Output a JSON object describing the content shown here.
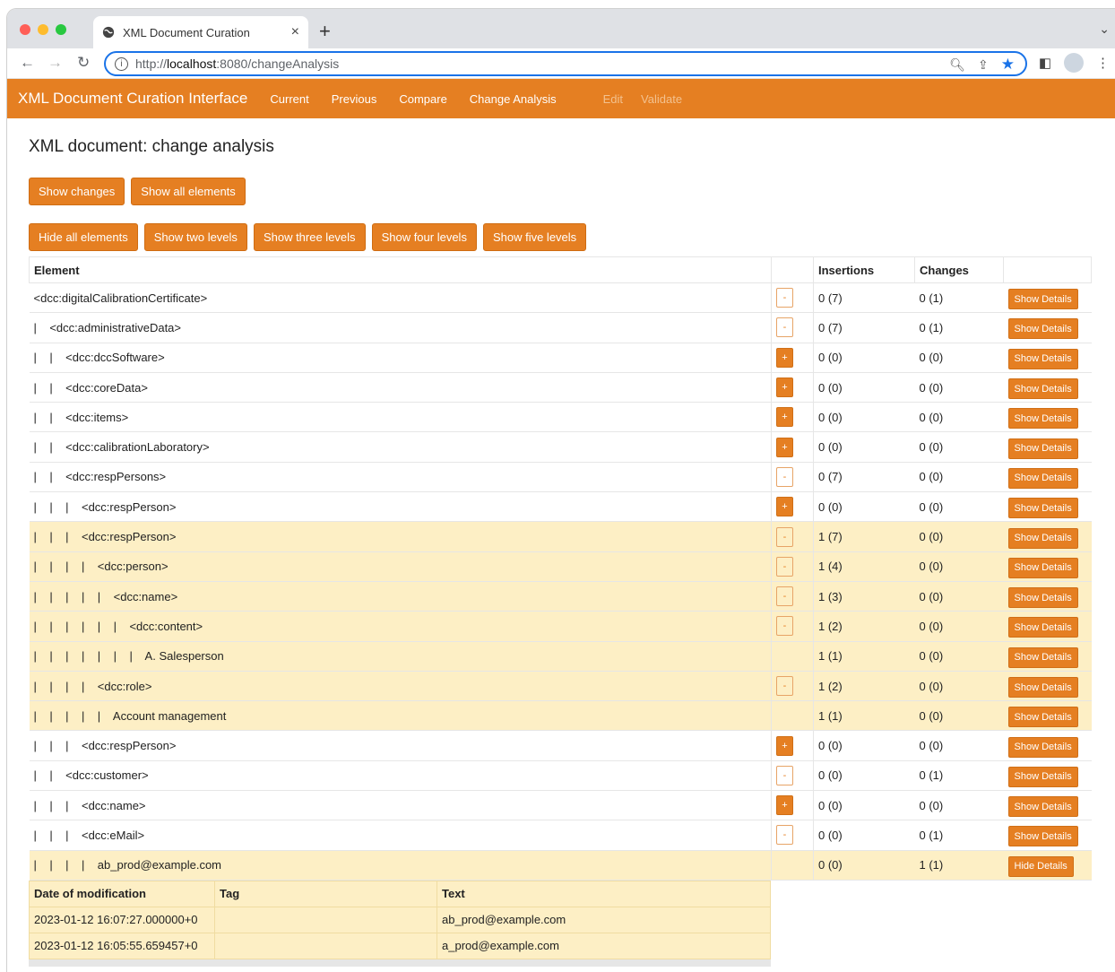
{
  "browser": {
    "tab_title": "XML Document Curation",
    "close_label": "×",
    "new_tab_label": "+",
    "url_prefix": "http://",
    "url_host": "localhost",
    "url_path": ":8080/changeAnalysis"
  },
  "app": {
    "brand": "XML Document Curation Interface",
    "nav": [
      "Current",
      "Previous",
      "Compare",
      "Change Analysis",
      "Edit",
      "Validate"
    ],
    "accent": "#e57f22"
  },
  "page": {
    "title": "XML document: change analysis",
    "buttons_row1": [
      "Show changes",
      "Show all elements"
    ],
    "buttons_row2": [
      "Hide all elements",
      "Show two levels",
      "Show three levels",
      "Show four levels",
      "Show five levels"
    ]
  },
  "table": {
    "headers": [
      "Element",
      "",
      "Insertions",
      "Changes",
      ""
    ],
    "rows": [
      {
        "element": "<dcc:digitalCalibrationCertificate>",
        "toggle": "-",
        "insertions": "0 (7)",
        "changes": "0 (1)",
        "action": "Show Details",
        "highlight": false
      },
      {
        "element": "|    <dcc:administrativeData>",
        "toggle": "-",
        "insertions": "0 (7)",
        "changes": "0 (1)",
        "action": "Show Details",
        "highlight": false
      },
      {
        "element": "|    |    <dcc:dccSoftware>",
        "toggle": "+",
        "insertions": "0 (0)",
        "changes": "0 (0)",
        "action": "Show Details",
        "highlight": false
      },
      {
        "element": "|    |    <dcc:coreData>",
        "toggle": "+",
        "insertions": "0 (0)",
        "changes": "0 (0)",
        "action": "Show Details",
        "highlight": false
      },
      {
        "element": "|    |    <dcc:items>",
        "toggle": "+",
        "insertions": "0 (0)",
        "changes": "0 (0)",
        "action": "Show Details",
        "highlight": false
      },
      {
        "element": "|    |    <dcc:calibrationLaboratory>",
        "toggle": "+",
        "insertions": "0 (0)",
        "changes": "0 (0)",
        "action": "Show Details",
        "highlight": false
      },
      {
        "element": "|    |    <dcc:respPersons>",
        "toggle": "-",
        "insertions": "0 (7)",
        "changes": "0 (0)",
        "action": "Show Details",
        "highlight": false
      },
      {
        "element": "|    |    |    <dcc:respPerson>",
        "toggle": "+",
        "insertions": "0 (0)",
        "changes": "0 (0)",
        "action": "Show Details",
        "highlight": false
      },
      {
        "element": "|    |    |    <dcc:respPerson>",
        "toggle": "-",
        "insertions": "1 (7)",
        "changes": "0 (0)",
        "action": "Show Details",
        "highlight": true
      },
      {
        "element": "|    |    |    |    <dcc:person>",
        "toggle": "-",
        "insertions": "1 (4)",
        "changes": "0 (0)",
        "action": "Show Details",
        "highlight": true
      },
      {
        "element": "|    |    |    |    |    <dcc:name>",
        "toggle": "-",
        "insertions": "1 (3)",
        "changes": "0 (0)",
        "action": "Show Details",
        "highlight": true
      },
      {
        "element": "|    |    |    |    |    |    <dcc:content>",
        "toggle": "-",
        "insertions": "1 (2)",
        "changes": "0 (0)",
        "action": "Show Details",
        "highlight": true
      },
      {
        "element": "|    |    |    |    |    |    |    A. Salesperson",
        "toggle": "",
        "insertions": "1 (1)",
        "changes": "0 (0)",
        "action": "Show Details",
        "highlight": true
      },
      {
        "element": "|    |    |    |    <dcc:role>",
        "toggle": "-",
        "insertions": "1 (2)",
        "changes": "0 (0)",
        "action": "Show Details",
        "highlight": true
      },
      {
        "element": "|    |    |    |    |    Account management",
        "toggle": "",
        "insertions": "1 (1)",
        "changes": "0 (0)",
        "action": "Show Details",
        "highlight": true
      },
      {
        "element": "|    |    |    <dcc:respPerson>",
        "toggle": "+",
        "insertions": "0 (0)",
        "changes": "0 (0)",
        "action": "Show Details",
        "highlight": false
      },
      {
        "element": "|    |    <dcc:customer>",
        "toggle": "-",
        "insertions": "0 (0)",
        "changes": "0 (1)",
        "action": "Show Details",
        "highlight": false
      },
      {
        "element": "|    |    |    <dcc:name>",
        "toggle": "+",
        "insertions": "0 (0)",
        "changes": "0 (0)",
        "action": "Show Details",
        "highlight": false
      },
      {
        "element": "|    |    |    <dcc:eMail>",
        "toggle": "-",
        "insertions": "0 (0)",
        "changes": "0 (1)",
        "action": "Show Details",
        "highlight": false
      },
      {
        "element": "|    |    |    |    ab_prod@example.com",
        "toggle": "",
        "insertions": "0 (0)",
        "changes": "1 (1)",
        "action": "Hide Details",
        "highlight": true
      }
    ]
  },
  "details": {
    "headers": [
      "Date of modification",
      "Tag",
      "Text"
    ],
    "rows": [
      [
        "2023-01-12 16:07:27.000000+0",
        "",
        "ab_prod@example.com"
      ],
      [
        "2023-01-12 16:05:55.659457+0",
        "",
        "a_prod@example.com"
      ]
    ]
  }
}
